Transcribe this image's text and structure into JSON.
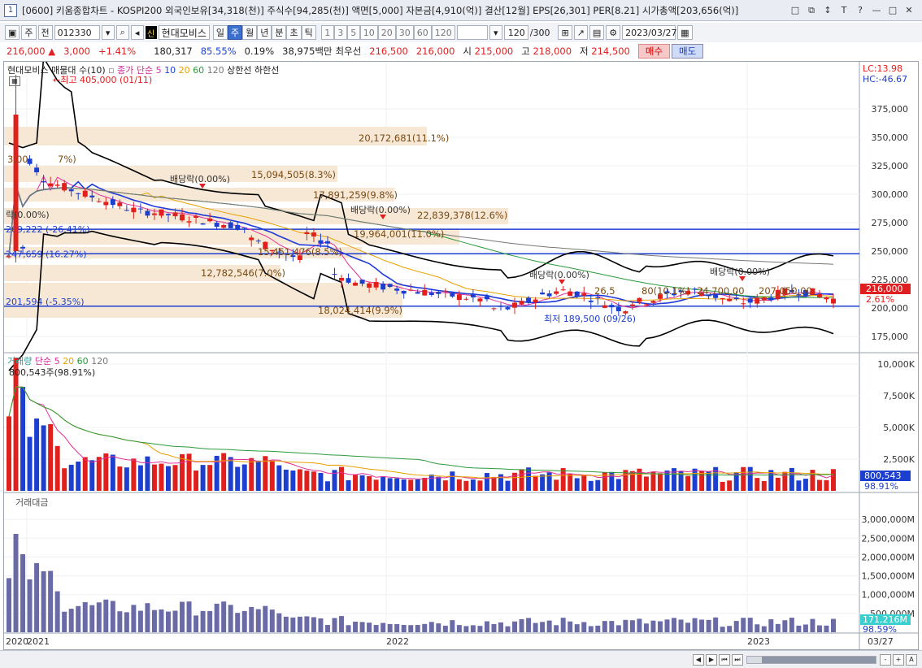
{
  "window": {
    "number": "1",
    "title": "[0600] 키움종합차트 - KOSPI200 외국인보유[34,318(천)] 주식수[94,285(천)] 액면[5,000] 자본금[4,910(억)] 결산[12월] EPS[26,301] PER[8.21] 시가총액[203,656(억)]",
    "controls": [
      "□",
      "⧉",
      "↕",
      "T",
      "?",
      "—",
      "□",
      "✕"
    ]
  },
  "toolbar": {
    "period_label": "주",
    "prev_label": "전",
    "code": "012330",
    "sin": "신",
    "stock_name": "현대모비스",
    "period_tabs": [
      "일",
      "주",
      "월",
      "년",
      "분",
      "초",
      "틱"
    ],
    "active_period": "주",
    "intervals": [
      "1",
      "3",
      "5",
      "10",
      "20",
      "30",
      "60",
      "120"
    ],
    "count": "120",
    "count_total": "/300",
    "date": "2023/03/27"
  },
  "price_bar": {
    "price": "216,000",
    "change": "3,000",
    "change_pct": "+1.41%",
    "volume": "180,317",
    "vol_ratio": "85.55%",
    "turnover": "0.19%",
    "amount": "38,975백만",
    "best_ask_label": "최우선",
    "ask": "216,500",
    "bid": "216,000",
    "open_label": "시",
    "open": "215,000",
    "high_label": "고",
    "high": "218,000",
    "low_label": "저",
    "low": "214,500",
    "buy_label": "매수",
    "sell_label": "매도"
  },
  "price_panel": {
    "legend_stock": "현대모비스 매물대 수(10)",
    "legend_close": "종가 단순",
    "ma_periods": [
      "5",
      "10",
      "20",
      "60",
      "120"
    ],
    "ma_colors": [
      "#e0309a",
      "#1e3ad8",
      "#e8a000",
      "#2b9a3a",
      "#777777"
    ],
    "legend_upper": "상한선",
    "legend_lower": "하한선",
    "lc_label": "LC:13.98",
    "hc_label": "HC:-46.67",
    "current_price_tag": "216,000",
    "current_pct_tag": "2.61%",
    "y_ticks": [
      "375,000",
      "350,000",
      "325,000",
      "300,000",
      "275,000",
      "250,000",
      "225,000",
      "200,000",
      "175,000"
    ],
    "annotations": {
      "max_label": "←최고 405,000 (01/11)",
      "min_label": "최저 189,500 (09/26)",
      "dividend": "배당락(0.00%)",
      "hline1": "269,222 (-26.41%)",
      "hline2": "247,659 (16.27%)",
      "hline3": "201,594 (-5.35%)",
      "partial_left": "3,00",
      "partial_left2": "7%)",
      "partial_div": "락(0.00%)"
    },
    "volume_profile": [
      "20,172,681(11.1%)",
      "15,094,505(8.3%)",
      "17,891,259(9.8%)",
      "22,839,378(12.6%)",
      "19,964,001(11.0%)",
      "15,451,476(8.5%)",
      "12,782,546(7.0%)",
      "18,024,414(9.9%)",
      "26,5",
      "80(10.1%)",
      "24,700,00",
      "207,050,00"
    ]
  },
  "volume_panel": {
    "legend_title": "거래량",
    "legend_ma": "단순",
    "ma_periods": [
      "5",
      "20",
      "60",
      "120"
    ],
    "peak_label": "800,543주(98.91%)",
    "y_ticks": [
      "10,000K",
      "7,500K",
      "5,000K",
      "2,500K"
    ],
    "current_tag": "800,543",
    "current_pct": "98.91%"
  },
  "amount_panel": {
    "legend_title": "거래대금",
    "y_ticks": [
      "3,000,000M",
      "2,500,000M",
      "2,000,000M",
      "1,500,000M",
      "1,000,000M",
      "500,000M"
    ],
    "current_tag": "171,216M",
    "current_pct": "98.59%"
  },
  "x_axis": {
    "labels": [
      "2020",
      "2021",
      "2022",
      "2023"
    ],
    "end_label": "03/27"
  },
  "scroll": {
    "buttons": [
      "◀",
      "▶",
      "⏮",
      "⏭"
    ],
    "zoom": [
      "-",
      "+",
      "A"
    ]
  }
}
